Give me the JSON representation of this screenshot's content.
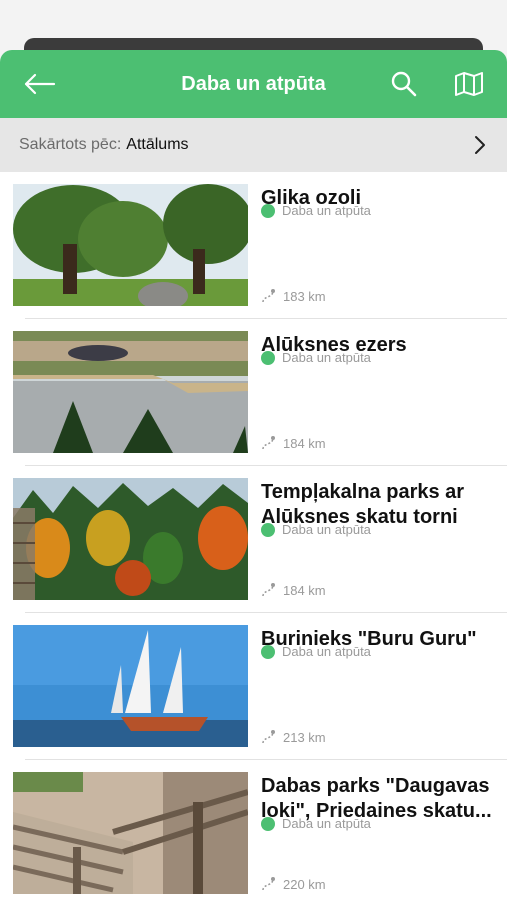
{
  "header": {
    "title": "Daba un atpūta",
    "colors": {
      "accent": "#4cbf72"
    },
    "icons": {
      "back": "arrow-left-icon",
      "search": "search-icon",
      "map": "map-icon"
    }
  },
  "sort": {
    "prefix": "Sakārtots pēc:",
    "value": "Attālums"
  },
  "places": [
    {
      "name": "Glika ozoli",
      "category": "Daba un atpūta",
      "distance": "183 km"
    },
    {
      "name": "Alūksnes ezers",
      "category": "Daba un atpūta",
      "distance": "184 km"
    },
    {
      "name": "Tempļakalna parks ar Alūksnes skatu torni",
      "category": "Daba un atpūta",
      "distance": "184 km"
    },
    {
      "name": "Burinieks \"Buru Guru\"",
      "category": "Daba un atpūta",
      "distance": "213 km"
    },
    {
      "name": "Dabas parks \"Daugavas loki\", Priedaines skatu...",
      "category": "Daba un atpūta",
      "distance": "220 km"
    }
  ]
}
